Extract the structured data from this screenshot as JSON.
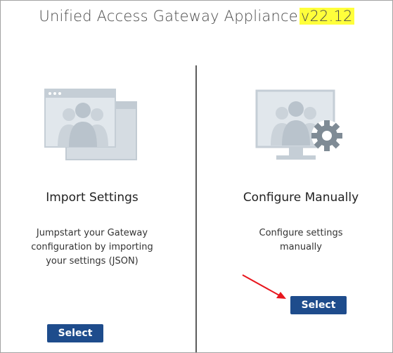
{
  "header": {
    "title": "Unified Access Gateway Appliance",
    "version": "v22.12"
  },
  "cards": [
    {
      "title": "Import Settings",
      "description": "Jumpstart your Gateway configuration by importing your settings (JSON)",
      "button_label": "Select",
      "icon": "import-settings-icon"
    },
    {
      "title": "Configure Manually",
      "description": "Configure settings manually",
      "button_label": "Select",
      "icon": "configure-manually-icon"
    }
  ],
  "colors": {
    "button": "#1e4c8c",
    "highlight": "#ffff3b",
    "arrow": "#e8161d",
    "illustration": "#c5ced6"
  },
  "annotation": {
    "icon": "red-arrow-icon"
  }
}
